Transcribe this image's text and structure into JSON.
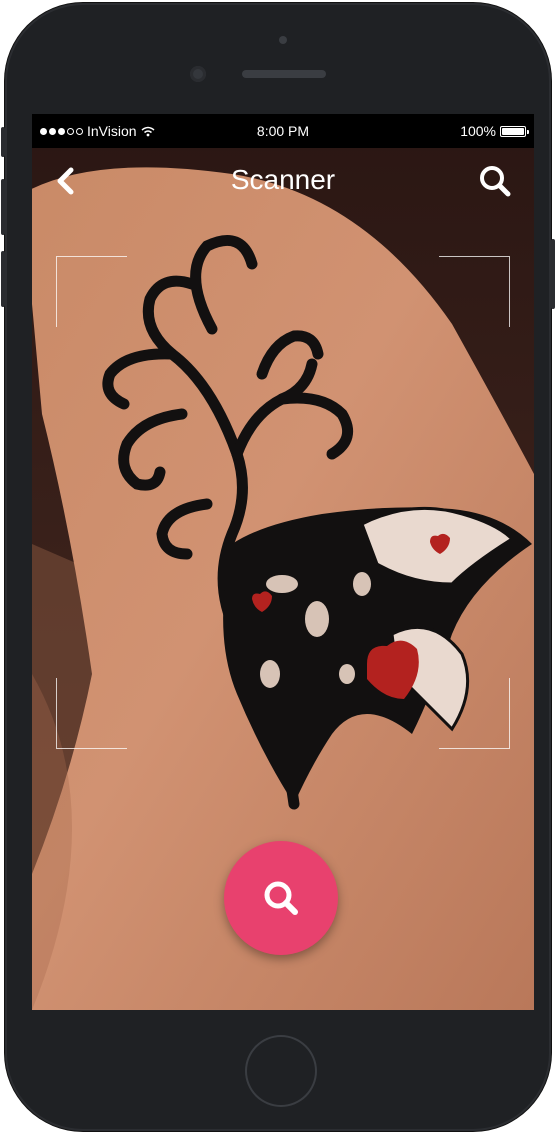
{
  "status_bar": {
    "carrier": "InVision",
    "time": "8:00 PM",
    "battery_percent": "100%",
    "signal_bars_filled": 3,
    "signal_bars_total": 5
  },
  "nav": {
    "title": "Scanner",
    "back_icon": "chevron-left-icon",
    "search_icon": "search-icon"
  },
  "scanner": {
    "fab_icon": "search-icon",
    "fab_color": "#e8416e"
  },
  "colors": {
    "accent": "#e8416e",
    "device_body": "#1f2124",
    "status_bar_bg": "#000000"
  }
}
